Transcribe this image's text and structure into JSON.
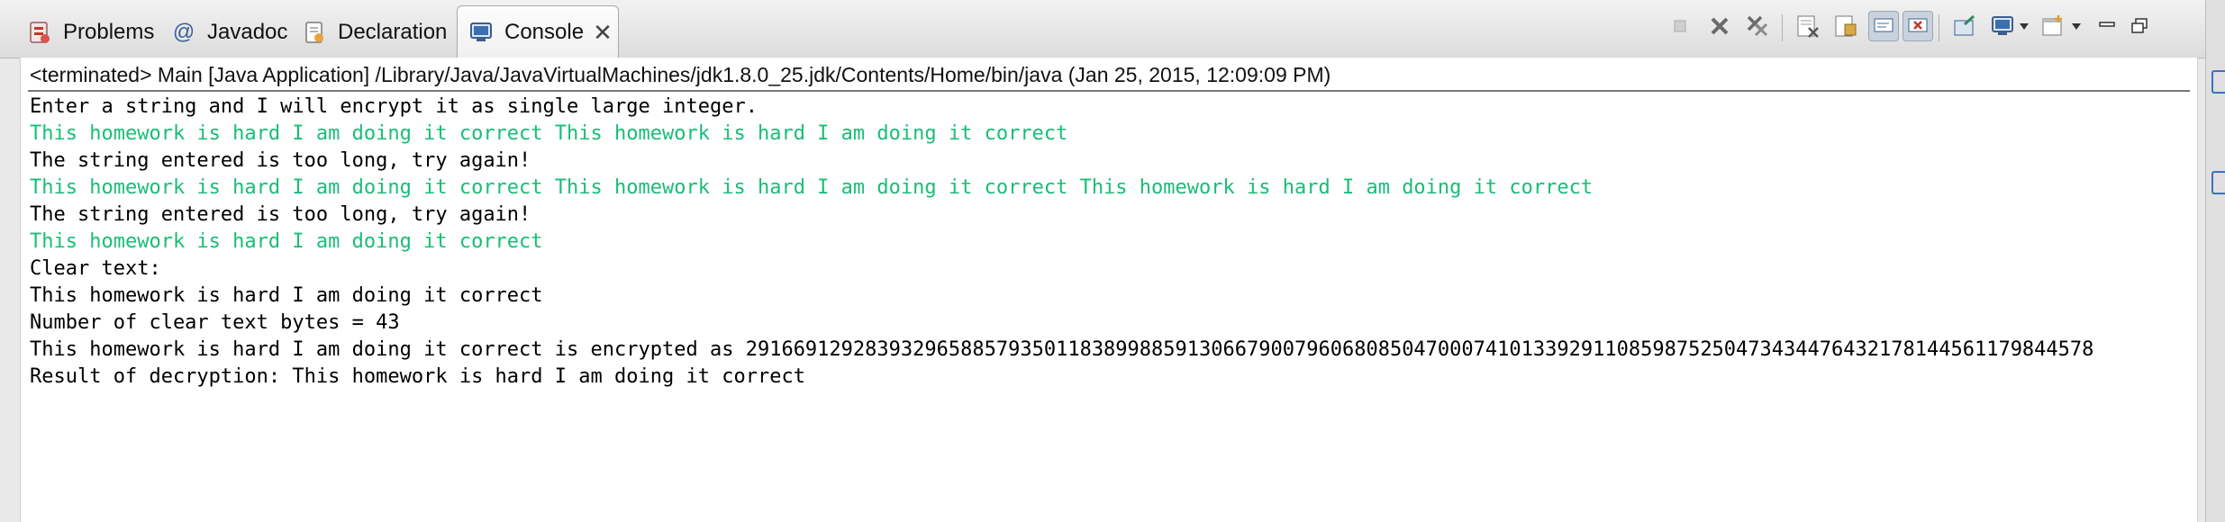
{
  "tabs": {
    "problems": {
      "label": "Problems",
      "icon": "problems-icon"
    },
    "javadoc": {
      "label": "Javadoc",
      "icon": "at-sign-icon"
    },
    "declaration": {
      "label": "Declaration",
      "icon": "declaration-icon"
    },
    "console": {
      "label": "Console",
      "icon": "console-icon",
      "active": true
    }
  },
  "toolbar": {
    "buttons": [
      "terminate-icon",
      "remove-launch-icon",
      "remove-all-terminated-icon",
      "clear-console-icon",
      "scroll-lock-icon",
      "show-console-on-stdout-icon",
      "show-console-on-stderr-icon",
      "pin-console-icon",
      "display-selected-console-icon",
      "open-console-icon",
      "minimize-icon",
      "maximize-icon"
    ]
  },
  "console": {
    "header": "<terminated> Main [Java Application] /Library/Java/JavaVirtualMachines/jdk1.8.0_25.jdk/Contents/Home/bin/java (Jan 25, 2015, 12:09:09 PM)",
    "colors": {
      "output": "#000000",
      "user_input": "#19bd78"
    },
    "lines": [
      {
        "text": "Enter a string and I will encrypt it as single large integer.",
        "kind": "output"
      },
      {
        "text": "This homework is hard I am doing it correct This homework is hard I am doing it correct",
        "kind": "input"
      },
      {
        "text": "The string entered is too long, try again!",
        "kind": "output"
      },
      {
        "text": "This homework is hard I am doing it correct This homework is hard I am doing it correct This homework is hard I am doing it correct",
        "kind": "input"
      },
      {
        "text": "The string entered is too long, try again!",
        "kind": "output"
      },
      {
        "text": "This homework is hard I am doing it correct",
        "kind": "input"
      },
      {
        "text": "Clear text:",
        "kind": "output"
      },
      {
        "text": "This homework is hard I am doing it correct",
        "kind": "output"
      },
      {
        "text": "Number of clear text bytes = 43",
        "kind": "output"
      },
      {
        "text": "This homework is hard I am doing it correct is encrypted as 29166912928393296588579350118389988591306679007960680850470007410133929110859875250473434476432178144561179844578",
        "kind": "output"
      },
      {
        "text": "Result of decryption: This homework is hard I am doing it correct",
        "kind": "output"
      }
    ]
  }
}
